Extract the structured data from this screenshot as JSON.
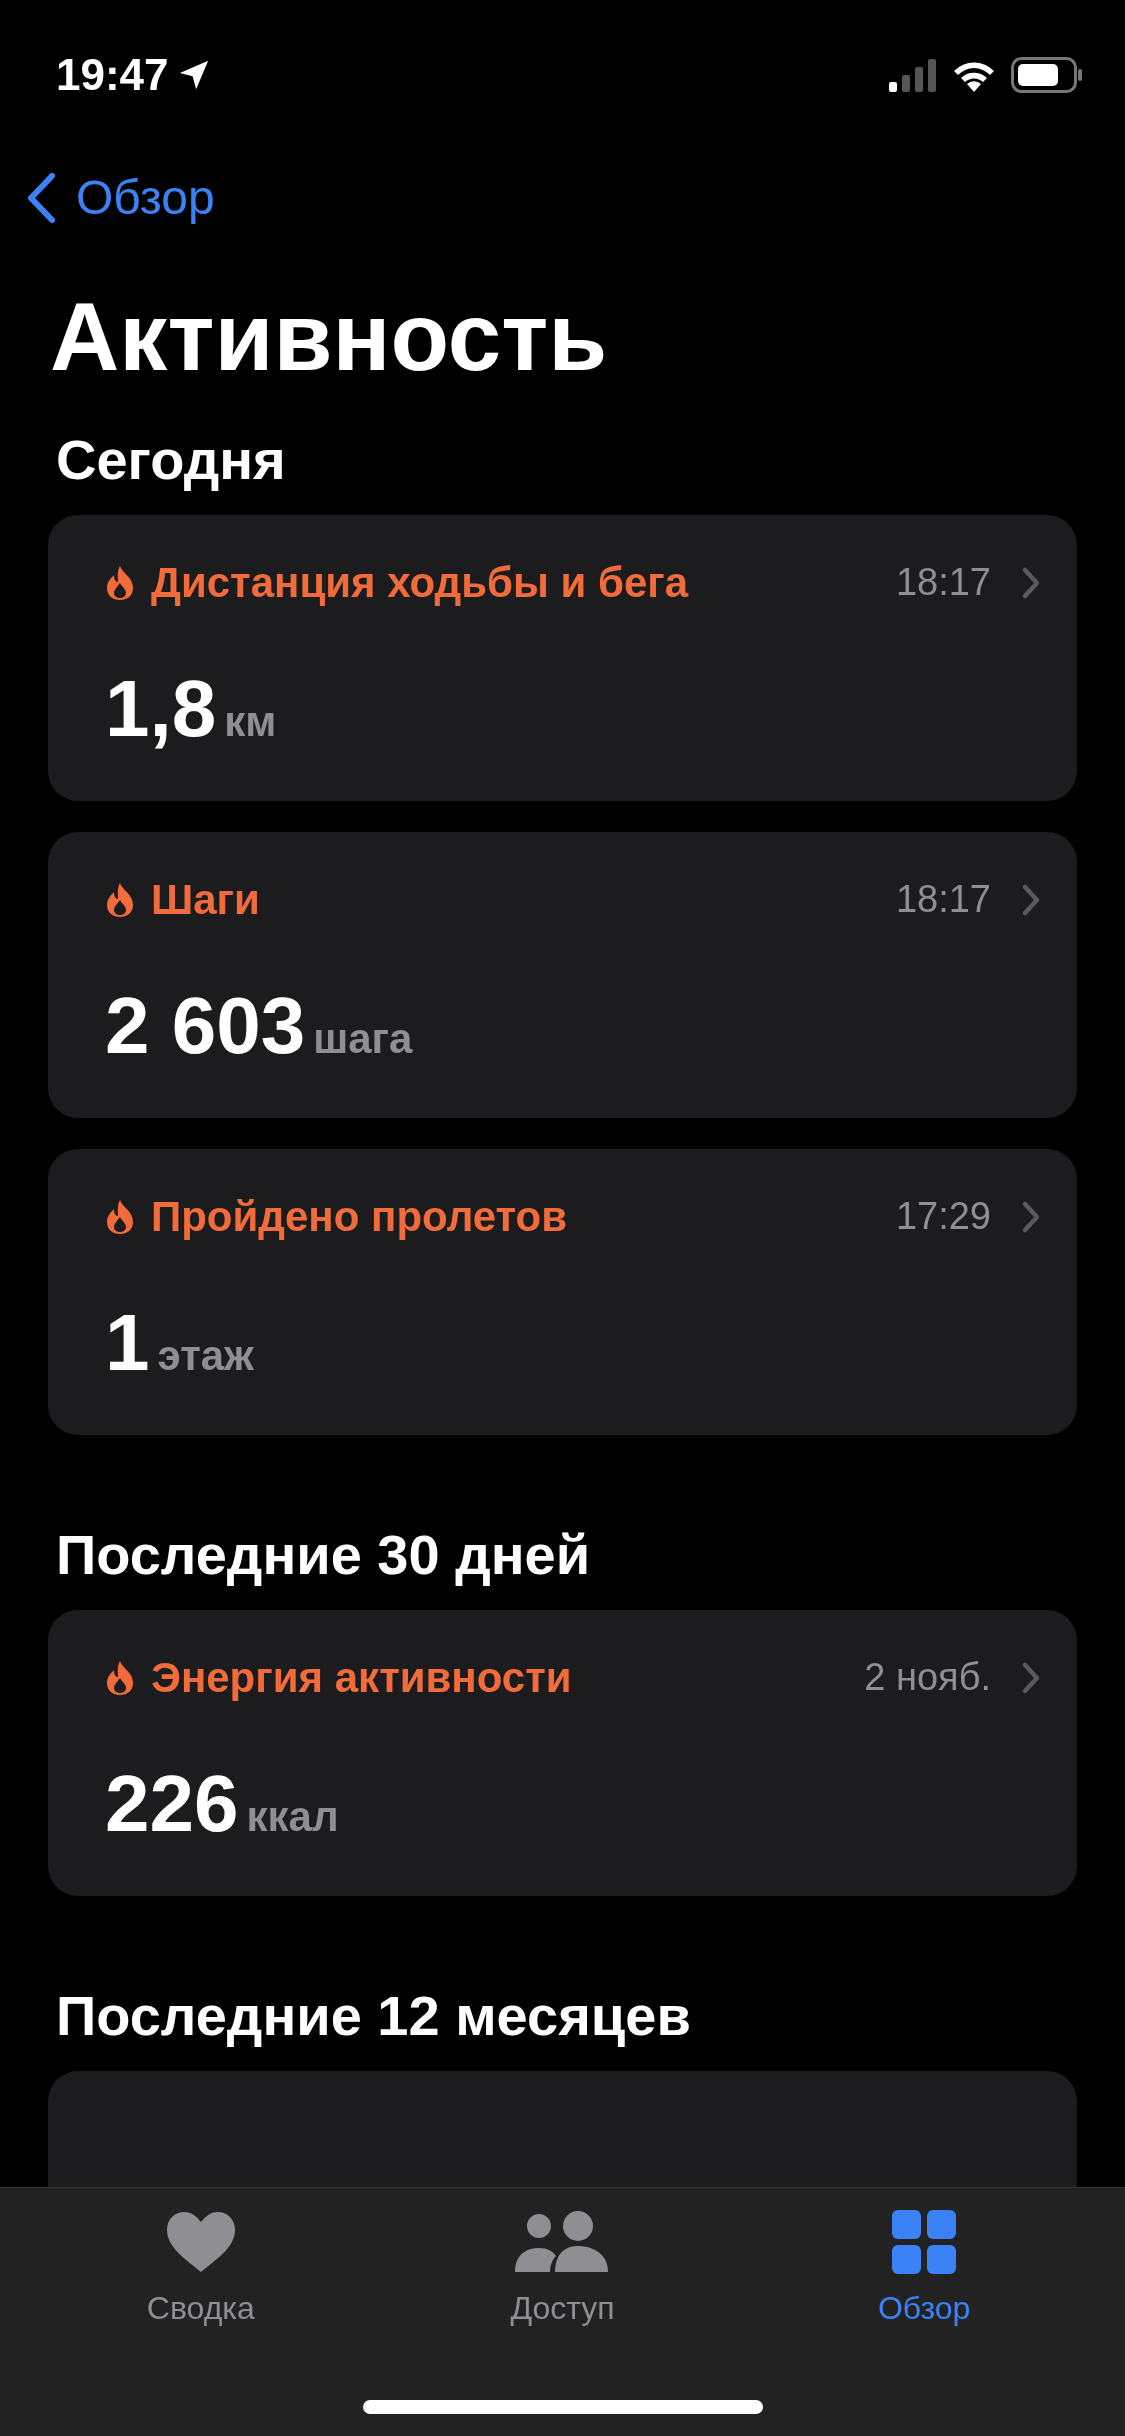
{
  "status_bar": {
    "time": "19:47"
  },
  "nav": {
    "back_label": "Обзор"
  },
  "title": "Активность",
  "sections": [
    {
      "heading": "Сегодня",
      "cards": [
        {
          "kind": "metric",
          "label": "Дистанция ходьбы и бега",
          "time": "18:17",
          "value": "1,8",
          "unit": "км"
        },
        {
          "kind": "metric",
          "label": "Шаги",
          "time": "18:17",
          "value": "2 603",
          "unit": "шага"
        },
        {
          "kind": "metric",
          "label": "Пройдено пролетов",
          "time": "17:29",
          "value": "1",
          "unit": "этаж"
        }
      ]
    },
    {
      "heading": "Последние 30 дней",
      "cards": [
        {
          "kind": "metric",
          "label": "Энергия активности",
          "time": "2 нояб.",
          "value": "226",
          "unit": "ккал"
        }
      ]
    },
    {
      "heading": "Последние 12 месяцев",
      "cards": [
        {
          "kind": "partial"
        }
      ]
    }
  ],
  "tabs": [
    {
      "label": "Сводка",
      "selected": false
    },
    {
      "label": "Доступ",
      "selected": false
    },
    {
      "label": "Обзор",
      "selected": true
    }
  ]
}
